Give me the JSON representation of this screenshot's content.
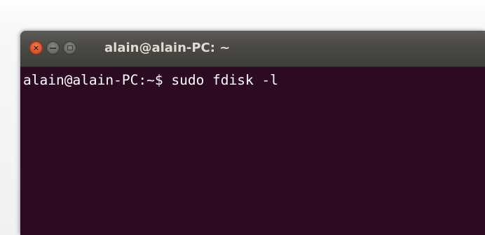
{
  "window": {
    "title": "alain@alain-PC: ~",
    "buttons": {
      "close_icon": "close-icon",
      "minimize_icon": "minimize-icon",
      "maximize_icon": "maximize-icon",
      "close_glyph": "×"
    }
  },
  "terminal": {
    "prompt": "alain@alain-PC:~$",
    "command": "sudo fdisk -l"
  },
  "colors": {
    "terminal_bg": "#2c0a22",
    "titlebar": "#4a4945",
    "close_button": "#e0552b",
    "text": "#ffffff"
  }
}
